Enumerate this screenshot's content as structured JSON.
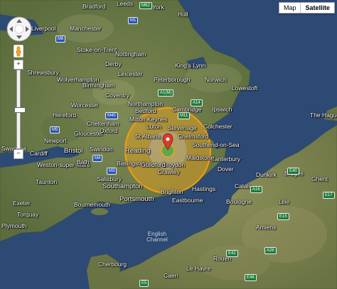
{
  "map_type": {
    "options": [
      "Map",
      "Satellite"
    ],
    "selected": "Satellite"
  },
  "controls": {
    "zoom_in_icon": "plus-icon",
    "zoom_out_icon": "minus-icon",
    "pan_icon": "pan-arrows-icon",
    "pegman_icon": "street-view-pegman-icon",
    "zoom_level_fraction": 0.5
  },
  "colors": {
    "sea": "#2f4a73",
    "land": "#6b7a48",
    "blast_outer": "#f3a31a",
    "blast_inner": "#9a9a9a",
    "blast_core": "#3fae3f",
    "marker": "#d93a2e"
  },
  "labels": {
    "leeds": "Leeds",
    "bradford": "Bradford",
    "york": "York",
    "hull": "Hull",
    "liverpool": "Liverpool",
    "manchester": "Manchester",
    "stoke": "Stoke-on-Trent",
    "nottingham": "Nottingham",
    "derby": "Derby",
    "shrewsbury": "Shrewsbury",
    "wolverhampton": "Wolverhampton",
    "birmingham": "Birmingham",
    "leicester": "Leicester",
    "kings_lynn": "King's Lynn",
    "norwich": "Norwich",
    "peterborough": "Peterborough",
    "lowestoft": "Lowestoft",
    "coventry": "Coventry",
    "northampton": "Northampton",
    "cambridge": "Cambridge",
    "ipswich": "Ipswich",
    "worcester": "Worcester",
    "hereford": "Hereford",
    "gloucester": "Gloucester",
    "cheltenham": "Cheltenham",
    "oxford": "Oxford",
    "bedford": "Bedford",
    "milton_keynes": "Milton Keynes",
    "luton": "Luton",
    "stevenage": "Stevenage",
    "colchester": "Colchester",
    "chelmsford": "Chelmsford",
    "st_albans": "St Albans",
    "southend": "Southend-on-Sea",
    "swansea": "Swansea",
    "cardiff": "Cardiff",
    "newport": "Newport",
    "bristol": "Bristol",
    "swindon": "Swindon",
    "reading": "Reading",
    "basingstoke": "Basingstoke",
    "croydon": "Croydon",
    "crawley": "Crawley",
    "canterbury": "Canterbury",
    "dover": "Dover",
    "maidstone": "Maidstone",
    "guildford": "Guildford",
    "weston": "Weston-super-Mare",
    "taunton": "Taunton",
    "bath": "Bath",
    "salisbury": "Salisbury",
    "southampton": "Southampton",
    "portsmouth": "Portsmouth",
    "brighton": "Brighton",
    "eastbourne": "Eastbourne",
    "exeter": "Exeter",
    "torquay": "Torquay",
    "plymouth": "Plymouth",
    "bournemouth": "Bournemouth",
    "hastings": "Hastings",
    "dunkirk": "Dunkirk",
    "calais": "Calais",
    "bruges": "Bruges",
    "ghent": "Ghent",
    "lille": "Lille",
    "boulogne": "Boulogne",
    "amiens": "Amiens",
    "le_havre": "Le Havre",
    "rouen": "Rouen",
    "caen": "Caen",
    "cherbourg": "Cherbourg",
    "the_hague": "The Hague",
    "english_channel": "English\nChannel"
  },
  "roads": {
    "m6": "M6",
    "m62": "M62",
    "m1": "M1",
    "m11": "M11",
    "m4": "M4",
    "m5": "M5",
    "a1m": "A1(M)",
    "m40": "M40",
    "a14": "A14",
    "m25": "M25",
    "m3": "M3",
    "e40": "E40",
    "e15": "E15",
    "e17": "E17",
    "e42": "E42",
    "e46": "E46",
    "e5": "E5",
    "a16": "A16",
    "a26": "A26"
  }
}
